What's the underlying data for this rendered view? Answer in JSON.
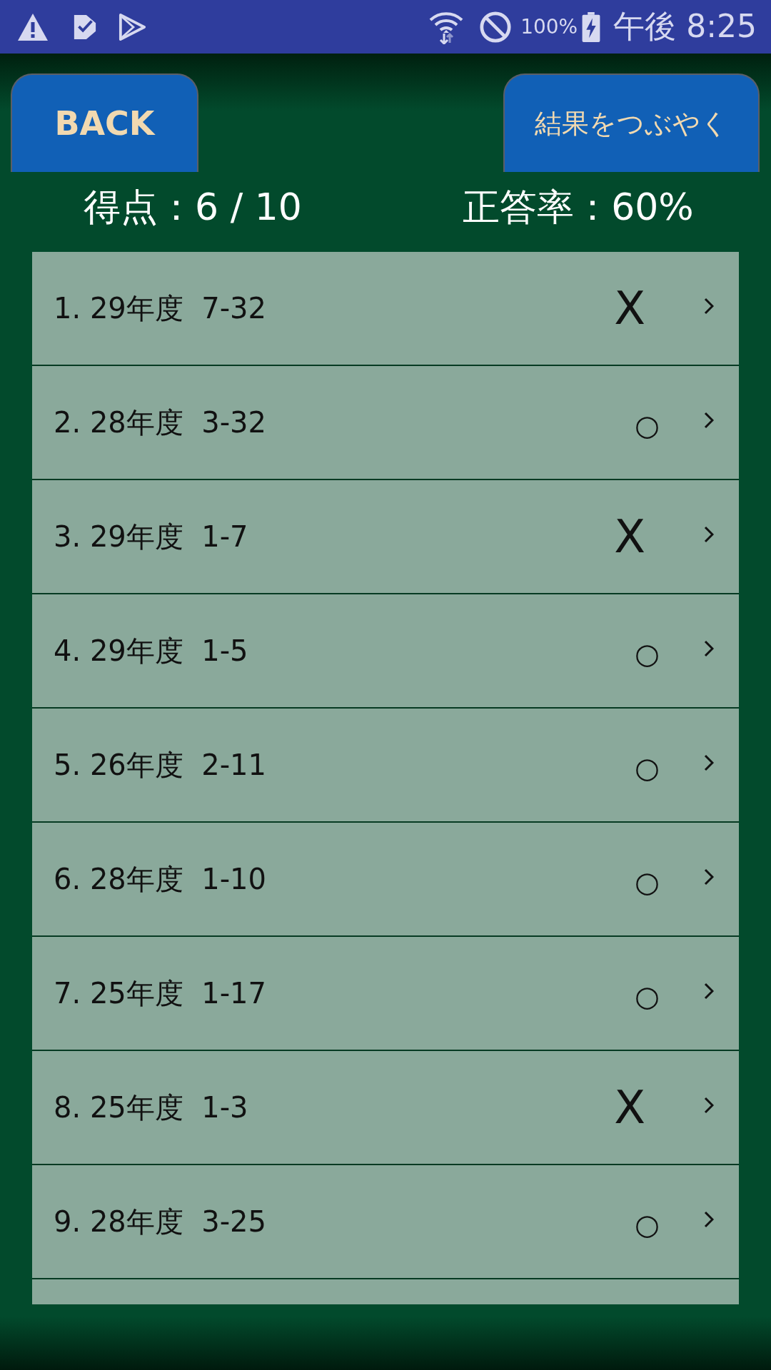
{
  "status_bar": {
    "battery": "100%",
    "time": "午後 8:25"
  },
  "header": {
    "back_button": "BACK",
    "tweet_button": "結果をつぶやく",
    "score": "得点：6 / 10",
    "accuracy": "正答率：60%"
  },
  "results": [
    {
      "label": "1. 29年度  7-32",
      "mark": "X",
      "correct": false
    },
    {
      "label": "2. 28年度  3-32",
      "mark": "○",
      "correct": true
    },
    {
      "label": "3. 29年度  1-7",
      "mark": "X",
      "correct": false
    },
    {
      "label": "4. 29年度  1-5",
      "mark": "○",
      "correct": true
    },
    {
      "label": "5. 26年度  2-11",
      "mark": "○",
      "correct": true
    },
    {
      "label": "6. 28年度  1-10",
      "mark": "○",
      "correct": true
    },
    {
      "label": "7. 25年度  1-17",
      "mark": "○",
      "correct": true
    },
    {
      "label": "8. 25年度  1-3",
      "mark": "X",
      "correct": false
    },
    {
      "label": "9. 28年度  3-25",
      "mark": "○",
      "correct": true
    }
  ]
}
